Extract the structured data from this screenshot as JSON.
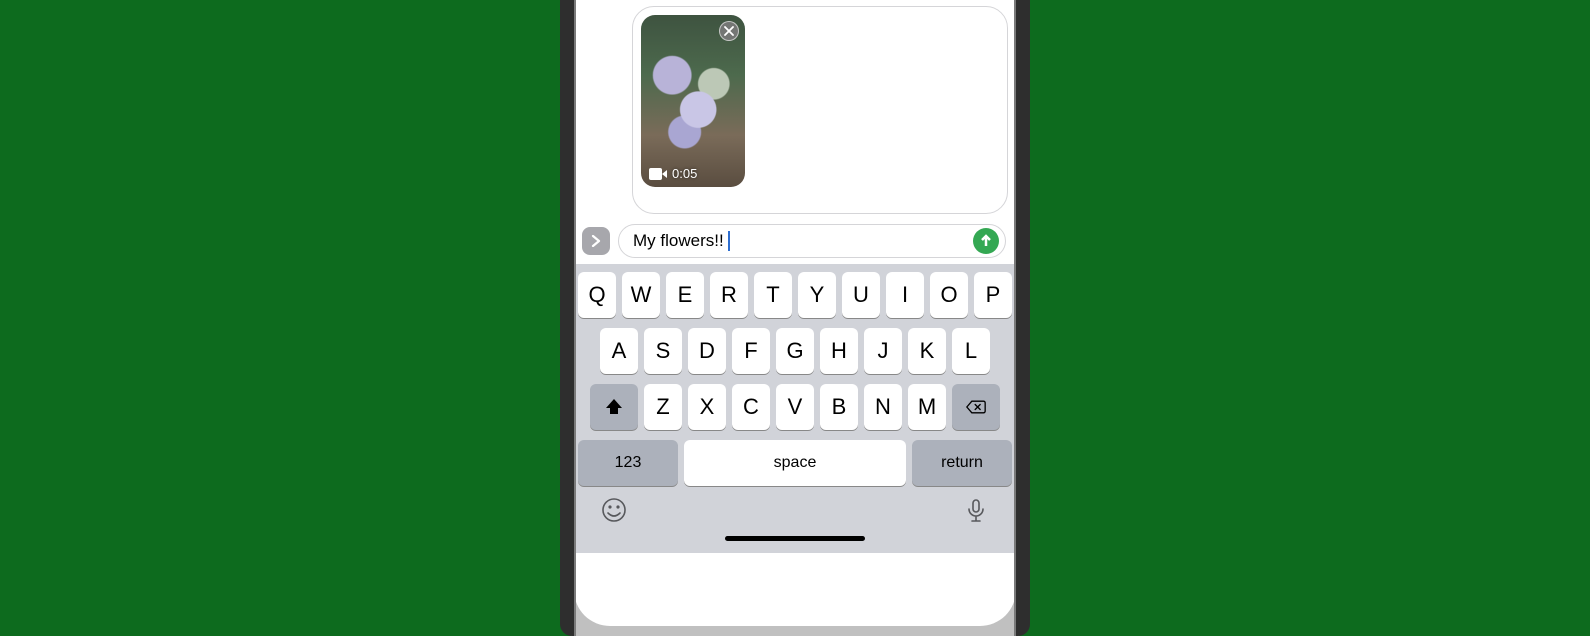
{
  "compose": {
    "attachment": {
      "type": "video",
      "duration": "0:05",
      "subject": "flowers"
    },
    "message_text": "My flowers!!"
  },
  "keyboard": {
    "row1": [
      "Q",
      "W",
      "E",
      "R",
      "T",
      "Y",
      "U",
      "I",
      "O",
      "P"
    ],
    "row2": [
      "A",
      "S",
      "D",
      "F",
      "G",
      "H",
      "J",
      "K",
      "L"
    ],
    "row3": [
      "Z",
      "X",
      "C",
      "V",
      "B",
      "N",
      "M"
    ],
    "numbers_key": "123",
    "space_key": "space",
    "return_key": "return"
  }
}
